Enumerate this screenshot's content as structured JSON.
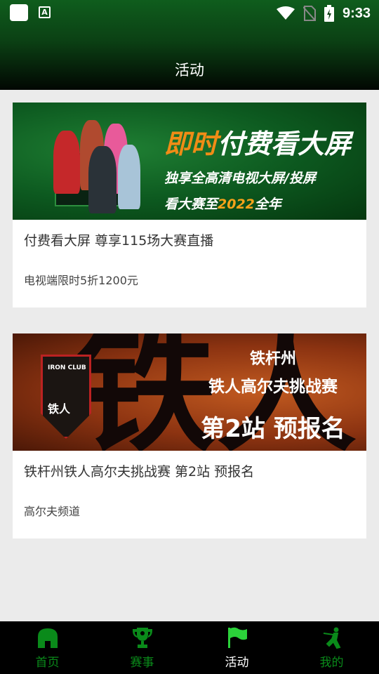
{
  "status_bar": {
    "time": "9:33"
  },
  "header": {
    "title": "活动"
  },
  "cards": [
    {
      "title": "付费看大屏 尊享115场大赛直播",
      "subtitle": "电视端限时5折1200元",
      "banner": {
        "headline_highlight": "即时",
        "headline_rest": "付费看大屏",
        "line1": "独享全高清电视大屏/投屏",
        "line2_pre": "看大赛至",
        "line2_year": "2022",
        "line2_post": "全年"
      }
    },
    {
      "title": "铁杆州铁人高尔夫挑战赛 第2站 预报名",
      "subtitle": "高尔夫频道",
      "banner": {
        "line1": "铁杆州",
        "line2": "铁人高尔夫挑战赛",
        "line3": "第2站 预报名",
        "char": "铁人",
        "badge_top": "IRON CLUB",
        "badge_bottom": "铁人"
      }
    }
  ],
  "tabs": [
    {
      "label": "首页",
      "icon": "home-icon",
      "active": false
    },
    {
      "label": "赛事",
      "icon": "trophy-icon",
      "active": false
    },
    {
      "label": "活动",
      "icon": "flag-icon",
      "active": true
    },
    {
      "label": "我的",
      "icon": "golfer-icon",
      "active": false
    }
  ],
  "colors": {
    "tab_green": "#0a8a1a",
    "header_green": "#0b4114"
  }
}
